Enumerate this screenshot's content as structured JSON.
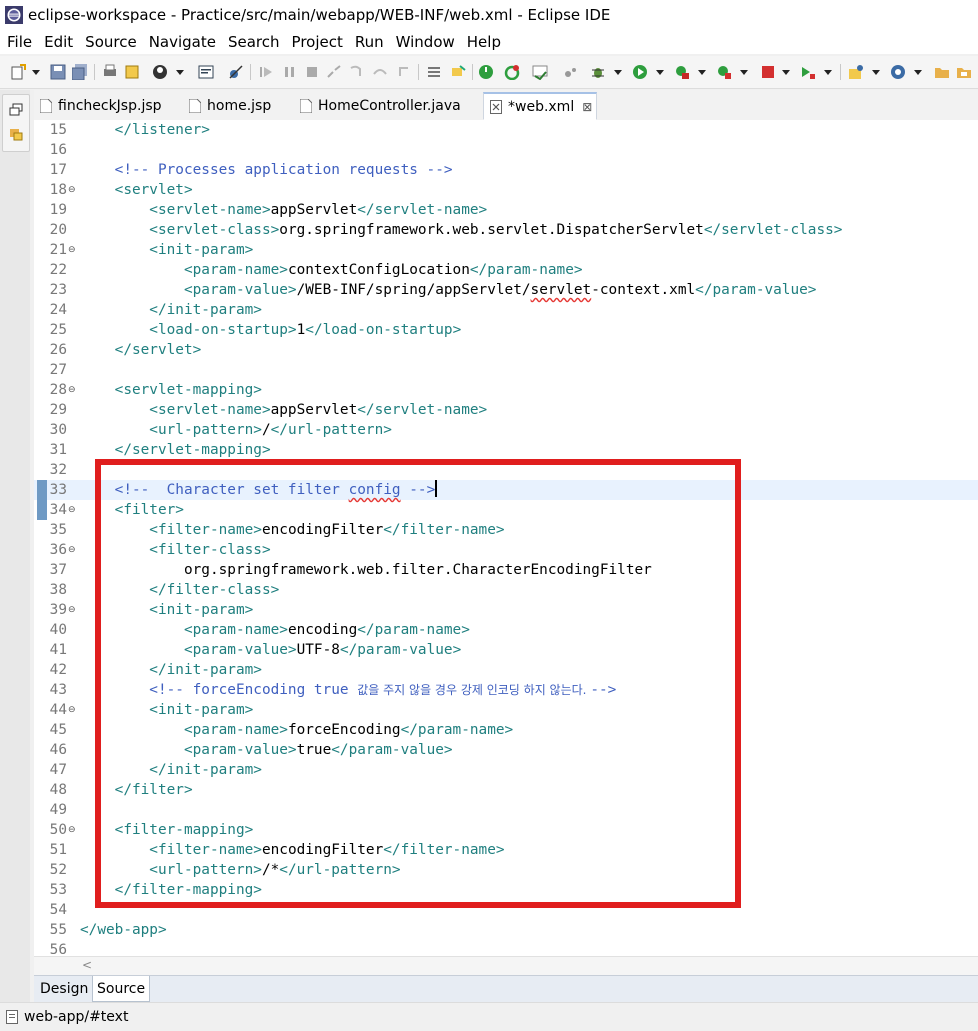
{
  "window": {
    "title": "eclipse-workspace - Practice/src/main/webapp/WEB-INF/web.xml - Eclipse IDE"
  },
  "menu": [
    "File",
    "Edit",
    "Source",
    "Navigate",
    "Search",
    "Project",
    "Run",
    "Window",
    "Help"
  ],
  "tabs": [
    {
      "label": "fincheckJsp.jsp",
      "active": false
    },
    {
      "label": "home.jsp",
      "active": false
    },
    {
      "label": "HomeController.java",
      "active": false
    },
    {
      "label": "*web.xml",
      "active": true,
      "close": "⊠"
    }
  ],
  "lines": [
    {
      "n": "15",
      "fold": "",
      "segs": [
        [
          "tag",
          "    </listener>"
        ]
      ]
    },
    {
      "n": "16",
      "fold": "",
      "segs": []
    },
    {
      "n": "17",
      "fold": "",
      "segs": [
        [
          "cmt",
          "    <!-- Processes application requests -->"
        ]
      ]
    },
    {
      "n": "18",
      "fold": "⊖",
      "segs": [
        [
          "tag",
          "    <servlet>"
        ]
      ]
    },
    {
      "n": "19",
      "fold": "",
      "segs": [
        [
          "tag",
          "        <servlet-name>"
        ],
        [
          "txt",
          "appServlet"
        ],
        [
          "tag",
          "</servlet-name>"
        ]
      ]
    },
    {
      "n": "20",
      "fold": "",
      "segs": [
        [
          "tag",
          "        <servlet-class>"
        ],
        [
          "txt",
          "org.springframework.web.servlet.DispatcherServlet"
        ],
        [
          "tag",
          "</servlet-class>"
        ]
      ]
    },
    {
      "n": "21",
      "fold": "⊖",
      "segs": [
        [
          "tag",
          "        <init-param>"
        ]
      ]
    },
    {
      "n": "22",
      "fold": "",
      "segs": [
        [
          "tag",
          "            <param-name>"
        ],
        [
          "txt",
          "contextConfigLocation"
        ],
        [
          "tag",
          "</param-name>"
        ]
      ]
    },
    {
      "n": "23",
      "fold": "",
      "segs": [
        [
          "tag",
          "            <param-value>"
        ],
        [
          "txt",
          "/WEB-INF/spring/appServlet/"
        ],
        [
          "txt squig",
          "servlet"
        ],
        [
          "txt",
          "-context.xml"
        ],
        [
          "tag",
          "</param-value>"
        ]
      ]
    },
    {
      "n": "24",
      "fold": "",
      "segs": [
        [
          "tag",
          "        </init-param>"
        ]
      ]
    },
    {
      "n": "25",
      "fold": "",
      "segs": [
        [
          "tag",
          "        <load-on-startup>"
        ],
        [
          "txt",
          "1"
        ],
        [
          "tag",
          "</load-on-startup>"
        ]
      ]
    },
    {
      "n": "26",
      "fold": "",
      "segs": [
        [
          "tag",
          "    </servlet>"
        ]
      ]
    },
    {
      "n": "27",
      "fold": "",
      "segs": []
    },
    {
      "n": "28",
      "fold": "⊖",
      "segs": [
        [
          "tag",
          "    <servlet-mapping>"
        ]
      ]
    },
    {
      "n": "29",
      "fold": "",
      "segs": [
        [
          "tag",
          "        <servlet-name>"
        ],
        [
          "txt",
          "appServlet"
        ],
        [
          "tag",
          "</servlet-name>"
        ]
      ]
    },
    {
      "n": "30",
      "fold": "",
      "segs": [
        [
          "tag",
          "        <url-pattern>"
        ],
        [
          "txt",
          "/"
        ],
        [
          "tag",
          "</url-pattern>"
        ]
      ]
    },
    {
      "n": "31",
      "fold": "",
      "segs": [
        [
          "tag",
          "    </servlet-mapping>"
        ]
      ]
    },
    {
      "n": "32",
      "fold": "",
      "segs": []
    },
    {
      "n": "33",
      "fold": "",
      "current": true,
      "segs": [
        [
          "cmt",
          "    <!--  Character set filter "
        ],
        [
          "cmt squig",
          "config"
        ],
        [
          "cmt",
          " -->"
        ]
      ],
      "caret": true
    },
    {
      "n": "34",
      "fold": "⊖",
      "segs": [
        [
          "tag",
          "    <filter>"
        ]
      ]
    },
    {
      "n": "35",
      "fold": "",
      "segs": [
        [
          "tag",
          "        <filter-name>"
        ],
        [
          "txt",
          "encodingFilter"
        ],
        [
          "tag",
          "</filter-name>"
        ]
      ]
    },
    {
      "n": "36",
      "fold": "⊖",
      "segs": [
        [
          "tag",
          "        <filter-class>"
        ]
      ]
    },
    {
      "n": "37",
      "fold": "",
      "segs": [
        [
          "txt",
          "            org.springframework.web.filter.CharacterEncodingFilter"
        ]
      ]
    },
    {
      "n": "38",
      "fold": "",
      "segs": [
        [
          "tag",
          "        </filter-class>"
        ]
      ]
    },
    {
      "n": "39",
      "fold": "⊖",
      "segs": [
        [
          "tag",
          "        <init-param>"
        ]
      ]
    },
    {
      "n": "40",
      "fold": "",
      "segs": [
        [
          "tag",
          "            <param-name>"
        ],
        [
          "txt",
          "encoding"
        ],
        [
          "tag",
          "</param-name>"
        ]
      ]
    },
    {
      "n": "41",
      "fold": "",
      "segs": [
        [
          "tag",
          "            <param-value>"
        ],
        [
          "txt",
          "UTF-8"
        ],
        [
          "tag",
          "</param-value>"
        ]
      ]
    },
    {
      "n": "42",
      "fold": "",
      "segs": [
        [
          "tag",
          "        </init-param>"
        ]
      ]
    },
    {
      "n": "43",
      "fold": "",
      "segs": [
        [
          "cmt",
          "        <!-- forceEncoding true "
        ],
        [
          "cmt kor",
          "값을 주지 않을 경우 강제 인코딩 하지 않는다. "
        ],
        [
          "cmt",
          "-->"
        ]
      ]
    },
    {
      "n": "44",
      "fold": "⊖",
      "segs": [
        [
          "tag",
          "        <init-param>"
        ]
      ]
    },
    {
      "n": "45",
      "fold": "",
      "segs": [
        [
          "tag",
          "            <param-name>"
        ],
        [
          "txt",
          "forceEncoding"
        ],
        [
          "tag",
          "</param-name>"
        ]
      ]
    },
    {
      "n": "46",
      "fold": "",
      "segs": [
        [
          "tag",
          "            <param-value>"
        ],
        [
          "txt",
          "true"
        ],
        [
          "tag",
          "</param-value>"
        ]
      ]
    },
    {
      "n": "47",
      "fold": "",
      "segs": [
        [
          "tag",
          "        </init-param>"
        ]
      ]
    },
    {
      "n": "48",
      "fold": "",
      "segs": [
        [
          "tag",
          "    </filter>"
        ]
      ]
    },
    {
      "n": "49",
      "fold": "",
      "segs": []
    },
    {
      "n": "50",
      "fold": "⊖",
      "segs": [
        [
          "tag",
          "    <filter-mapping>"
        ]
      ]
    },
    {
      "n": "51",
      "fold": "",
      "segs": [
        [
          "tag",
          "        <filter-name>"
        ],
        [
          "txt",
          "encodingFilter"
        ],
        [
          "tag",
          "</filter-name>"
        ]
      ]
    },
    {
      "n": "52",
      "fold": "",
      "segs": [
        [
          "tag",
          "        <url-pattern>"
        ],
        [
          "txt",
          "/*"
        ],
        [
          "tag",
          "</url-pattern>"
        ]
      ]
    },
    {
      "n": "53",
      "fold": "",
      "segs": [
        [
          "tag",
          "    </filter-mapping>"
        ]
      ]
    },
    {
      "n": "54",
      "fold": "",
      "segs": []
    },
    {
      "n": "55",
      "fold": "",
      "segs": [
        [
          "tag",
          "</web-app>"
        ]
      ]
    },
    {
      "n": "56",
      "fold": "",
      "segs": []
    }
  ],
  "bottom_tabs": [
    {
      "label": "Design",
      "active": false
    },
    {
      "label": "Source",
      "active": true
    }
  ],
  "status": {
    "text": "web-app/#text"
  },
  "colors": {
    "highlight_border": "#e01e1e",
    "tag": "#1f7f7f",
    "comment": "#3f5fbf",
    "current_line": "#e8f2fe"
  }
}
